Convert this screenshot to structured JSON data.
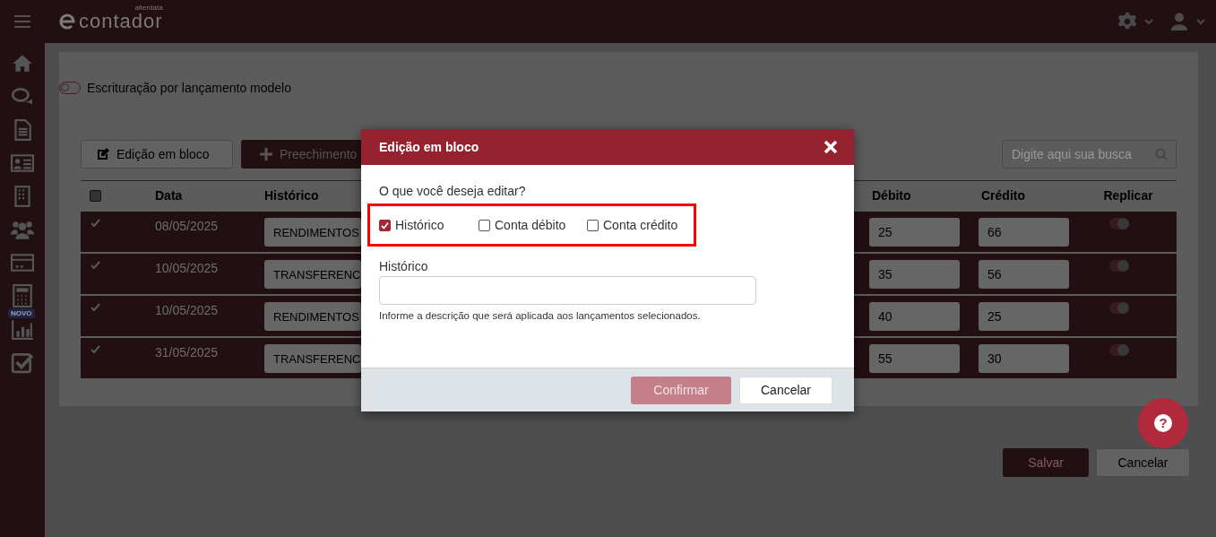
{
  "header": {
    "logo": "contador",
    "logo_tag": "alterdata"
  },
  "sidebar": {
    "badge": "NOVO"
  },
  "page": {
    "model_toggle": {
      "label": "Escrituração por lançamento modelo",
      "on": false
    },
    "toolbar": [
      "Edição em bloco",
      "Preechimento"
    ],
    "search": {
      "placeholder": "Digite aqui sua busca"
    },
    "table": {
      "select_all": {
        "checked": false
      },
      "columns": [
        "Data",
        "Histórico",
        "Débito",
        "Crédito",
        "Replicar"
      ],
      "rows": [
        {
          "selected": true,
          "data": "08/05/2025",
          "historico": "RENDIMENTOS",
          "debito": "25",
          "credito": "66",
          "replicar": true
        },
        {
          "selected": true,
          "data": "10/05/2025",
          "historico": "TRANSFERENC",
          "debito": "35",
          "credito": "56",
          "replicar": true
        },
        {
          "selected": true,
          "data": "10/05/2025",
          "historico": "RENDIMENTOS",
          "debito": "40",
          "credito": "25",
          "replicar": true
        },
        {
          "selected": true,
          "data": "31/05/2025",
          "historico": "TRANSFERENC",
          "debito": "55",
          "credito": "30",
          "replicar": true
        }
      ]
    },
    "actions": [
      "Salvar",
      "Cancelar"
    ]
  },
  "help_button": {
    "icon": "?"
  },
  "modal": {
    "title": "Edição em bloco",
    "question": "O que você deseja editar?",
    "options": [
      {
        "label": "Histórico",
        "checked": true
      },
      {
        "label": "Conta débito",
        "checked": false
      },
      {
        "label": "Conta crédito",
        "checked": false
      }
    ],
    "field": {
      "label": "Histórico",
      "hint": "Informe a descrição que será aplicada aos lançamentos selecionados."
    },
    "buttons": [
      {
        "label": "Confirmar",
        "disabled": true
      },
      {
        "label": "Cancelar",
        "disabled": false
      }
    ]
  }
}
